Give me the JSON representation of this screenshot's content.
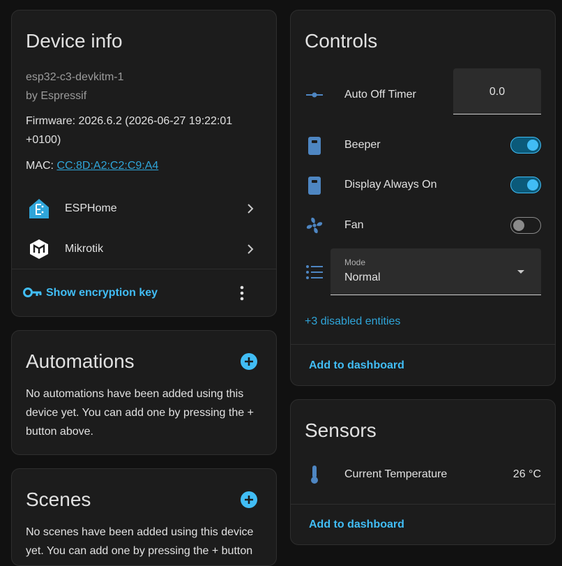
{
  "device_info": {
    "title": "Device info",
    "model": "esp32-c3-devkitm-1",
    "manufacturer": "by Espressif",
    "firmware_line1": "Firmware: 2026.6.2 (2026-06-27 19:22:01",
    "firmware_line2": "+0100)",
    "mac_label": "MAC:",
    "mac_value": "CC:8D:A2:C2:C9:A4",
    "integrations": [
      {
        "label": "ESPHome",
        "icon": "esphome-icon"
      },
      {
        "label": "Mikrotik",
        "icon": "mikrotik-icon"
      }
    ],
    "encryption_label": "Show encryption key"
  },
  "automations": {
    "title": "Automations",
    "line1": "No automations have been added using this",
    "line2": "device yet. You can add one by pressing the +",
    "line3": "button above."
  },
  "scenes": {
    "title": "Scenes",
    "line1": "No scenes have been added using this device",
    "line2": "yet. You can add one by pressing the + button"
  },
  "controls": {
    "title": "Controls",
    "auto_off": {
      "label": "Auto Off Timer",
      "value": "0.0"
    },
    "beeper": {
      "label": "Beeper",
      "on": true
    },
    "display": {
      "label": "Display Always On",
      "on": true
    },
    "fan": {
      "label": "Fan",
      "on": false
    },
    "mode": {
      "label": "Mode",
      "value": "Normal"
    },
    "disabled_entities": "+3 disabled entities",
    "add_to_dashboard": "Add to dashboard"
  },
  "sensors": {
    "title": "Sensors",
    "temperature": {
      "label": "Current Temperature",
      "value": "26 °C"
    },
    "add_to_dashboard": "Add to dashboard"
  },
  "colors": {
    "accent": "#41bdf5",
    "link": "#2fa5d9",
    "icon": "#4e86c2",
    "card": "#1c1c1c",
    "background": "#111111"
  }
}
